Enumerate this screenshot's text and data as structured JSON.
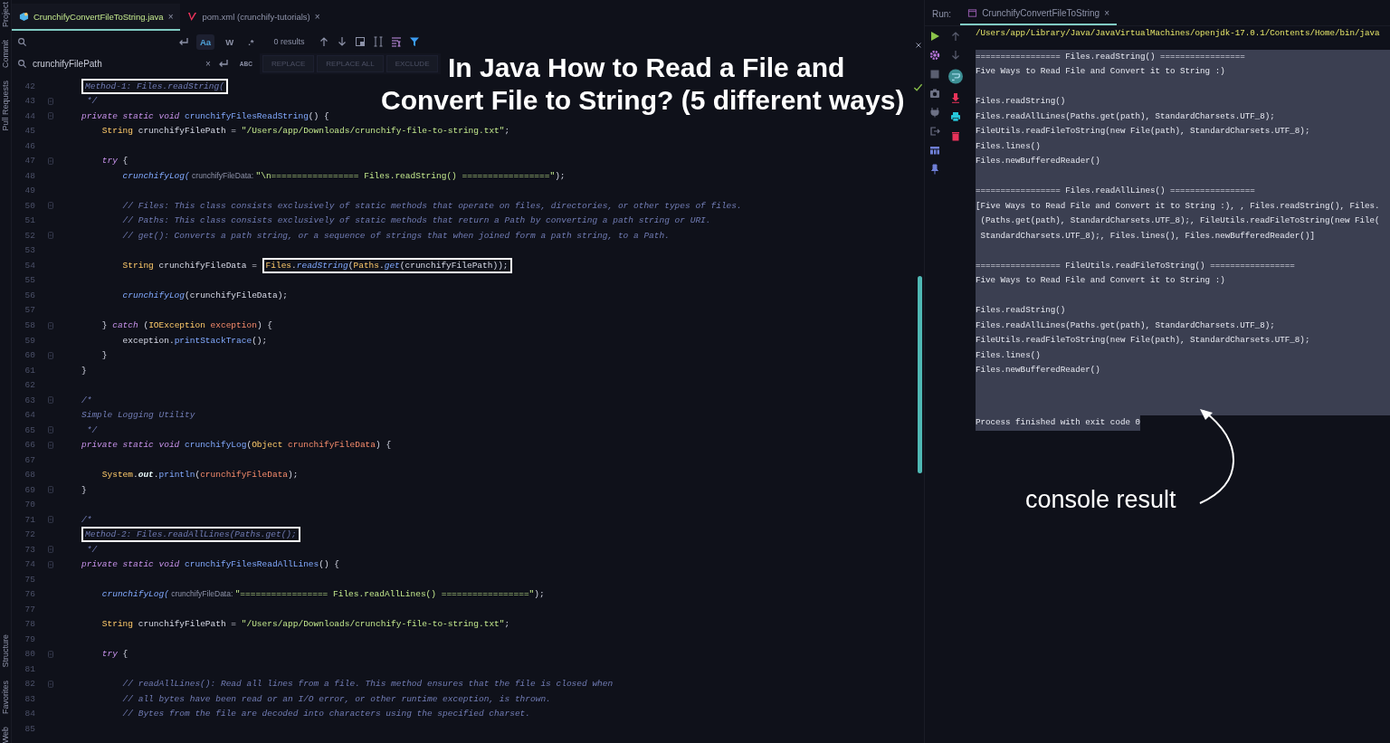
{
  "tool_strip": {
    "top": [
      {
        "label": "Project"
      },
      {
        "label": "Commit"
      },
      {
        "label": "Pull Requests"
      }
    ],
    "bottom": [
      {
        "label": "Structure"
      },
      {
        "label": "Favorites"
      },
      {
        "label": "Web"
      }
    ]
  },
  "editor_tabs": [
    {
      "label": "CrunchifyConvertFileToString.java",
      "close": "×",
      "kind": "java",
      "selected": true
    },
    {
      "label": "pom.xml (crunchify-tutorials)",
      "close": "×",
      "kind": "maven",
      "selected": false
    }
  ],
  "find_bar": {
    "options": [
      {
        "label": "Aa",
        "selected": true
      },
      {
        "label": "W",
        "selected": false
      },
      {
        "label": ".*",
        "selected": false
      }
    ],
    "results": "0 results"
  },
  "replace_bar": {
    "value": "crunchifyFilePath",
    "clear": "×",
    "preserve_case": "ABC",
    "buttons": [
      {
        "label": "REPLACE",
        "disabled": true
      },
      {
        "label": "REPLACE ALL",
        "disabled": true
      },
      {
        "label": "EXCLUDE",
        "disabled": true
      }
    ]
  },
  "code_lines": [
    {
      "number": "42",
      "fold": false,
      "boxed_tokens": [
        {
          "kind": "cm",
          "text": "Method-1: Files.readString("
        }
      ]
    },
    {
      "number": "43",
      "fold": true,
      "tokens": [
        {
          "kind": "cm",
          "text": " */"
        }
      ]
    },
    {
      "number": "44",
      "fold": true,
      "tokens": [
        {
          "kind": "kw",
          "text": "private static void "
        },
        {
          "kind": "fn",
          "text": "crunchifyFilesReadString"
        },
        {
          "kind": "pl",
          "text": "() {"
        }
      ]
    },
    {
      "number": "45",
      "fold": false,
      "tokens": [
        {
          "kind": "type",
          "text": "    String "
        },
        {
          "kind": "pl",
          "text": "crunchifyFilePath = "
        },
        {
          "kind": "str",
          "text": "\"/Users/app/Downloads/crunchify-file-to-string.txt\""
        },
        {
          "kind": "pl",
          "text": ";"
        }
      ]
    },
    {
      "number": "46",
      "fold": false
    },
    {
      "number": "47",
      "fold": true,
      "tokens": [
        {
          "kind": "kw",
          "text": "    try "
        },
        {
          "kind": "pl",
          "text": "{"
        }
      ]
    },
    {
      "number": "48",
      "fold": false,
      "tokens": [
        {
          "kind": "fni",
          "text": "        crunchifyLog("
        },
        {
          "kind": "hint",
          "text": " crunchifyFileData: "
        },
        {
          "kind": "str",
          "text": "\"\\n================= Files.readString() =================\""
        },
        {
          "kind": "pl",
          "text": ");"
        }
      ]
    },
    {
      "number": "49",
      "fold": false
    },
    {
      "number": "50",
      "fold": true,
      "tokens": [
        {
          "kind": "cm",
          "text": "        // Files: This class consists exclusively of static methods that operate on files, directories, or other types of files."
        }
      ]
    },
    {
      "number": "51",
      "fold": false,
      "tokens": [
        {
          "kind": "cm",
          "text": "        // Paths: This class consists exclusively of static methods that return a Path by converting a path string or URI."
        }
      ]
    },
    {
      "number": "52",
      "fold": true,
      "tokens": [
        {
          "kind": "cm",
          "text": "        // get(): Converts a path string, or a sequence of strings that when joined form a path string, to a Path."
        }
      ]
    },
    {
      "number": "53",
      "fold": false
    },
    {
      "number": "54",
      "fold": false,
      "tokens": [
        {
          "kind": "type",
          "text": "        String "
        },
        {
          "kind": "pl",
          "text": "crunchifyFileData = "
        }
      ],
      "boxed_tokens": [
        {
          "kind": "type",
          "text": "Files"
        },
        {
          "kind": "pl",
          "text": "."
        },
        {
          "kind": "fni",
          "text": "readString"
        },
        {
          "kind": "pl",
          "text": "("
        },
        {
          "kind": "type",
          "text": "Paths"
        },
        {
          "kind": "pl",
          "text": "."
        },
        {
          "kind": "fni",
          "text": "get"
        },
        {
          "kind": "pl",
          "text": "(crunchifyFilePath));"
        }
      ]
    },
    {
      "number": "55",
      "fold": false
    },
    {
      "number": "56",
      "fold": false,
      "tokens": [
        {
          "kind": "fni",
          "text": "        crunchifyLog"
        },
        {
          "kind": "pl",
          "text": "(crunchifyFileData);"
        }
      ]
    },
    {
      "number": "57",
      "fold": false
    },
    {
      "number": "58",
      "fold": true,
      "tokens": [
        {
          "kind": "pl",
          "text": "    } "
        },
        {
          "kind": "kw",
          "text": "catch "
        },
        {
          "kind": "pl",
          "text": "("
        },
        {
          "kind": "type",
          "text": "IOException "
        },
        {
          "kind": "var",
          "text": "exception"
        },
        {
          "kind": "pl",
          "text": ") {"
        }
      ]
    },
    {
      "number": "59",
      "fold": false,
      "tokens": [
        {
          "kind": "pl",
          "text": "        exception."
        },
        {
          "kind": "fn",
          "text": "printStackTrace"
        },
        {
          "kind": "pl",
          "text": "();"
        }
      ]
    },
    {
      "number": "60",
      "fold": true,
      "tokens": [
        {
          "kind": "pl",
          "text": "    }"
        }
      ]
    },
    {
      "number": "61",
      "fold": false,
      "tokens": [
        {
          "kind": "pl",
          "text": "}"
        }
      ]
    },
    {
      "number": "62",
      "fold": false
    },
    {
      "number": "63",
      "fold": true,
      "tokens": [
        {
          "kind": "cm",
          "text": "/*"
        }
      ]
    },
    {
      "number": "64",
      "fold": false,
      "tokens": [
        {
          "kind": "cm",
          "text": "Simple Logging Utility"
        }
      ]
    },
    {
      "number": "65",
      "fold": true,
      "tokens": [
        {
          "kind": "cm",
          "text": " */"
        }
      ]
    },
    {
      "number": "66",
      "fold": true,
      "tokens": [
        {
          "kind": "kw",
          "text": "private static void "
        },
        {
          "kind": "fn",
          "text": "crunchifyLog"
        },
        {
          "kind": "pl",
          "text": "("
        },
        {
          "kind": "type",
          "text": "Object "
        },
        {
          "kind": "var",
          "text": "crunchifyFileData"
        },
        {
          "kind": "pl",
          "text": ") {"
        }
      ]
    },
    {
      "number": "67",
      "fold": false
    },
    {
      "number": "68",
      "fold": false,
      "tokens": [
        {
          "kind": "type",
          "text": "    System"
        },
        {
          "kind": "pl",
          "text": "."
        },
        {
          "kind": "field",
          "text": "out"
        },
        {
          "kind": "pl",
          "text": "."
        },
        {
          "kind": "fn",
          "text": "println"
        },
        {
          "kind": "pl",
          "text": "("
        },
        {
          "kind": "var",
          "text": "crunchifyFileData"
        },
        {
          "kind": "pl",
          "text": ");"
        }
      ]
    },
    {
      "number": "69",
      "fold": true,
      "tokens": [
        {
          "kind": "pl",
          "text": "}"
        }
      ]
    },
    {
      "number": "70",
      "fold": false
    },
    {
      "number": "71",
      "fold": true,
      "tokens": [
        {
          "kind": "cm",
          "text": "/*"
        }
      ]
    },
    {
      "number": "72",
      "fold": false,
      "boxed_tokens": [
        {
          "kind": "cm",
          "text": "Method-2: Files.readAllLines(Paths.get();"
        }
      ]
    },
    {
      "number": "73",
      "fold": true,
      "tokens": [
        {
          "kind": "cm",
          "text": " */"
        }
      ]
    },
    {
      "number": "74",
      "fold": true,
      "tokens": [
        {
          "kind": "kw",
          "text": "private static void "
        },
        {
          "kind": "fn",
          "text": "crunchifyFilesReadAllLines"
        },
        {
          "kind": "pl",
          "text": "() {"
        }
      ]
    },
    {
      "number": "75",
      "fold": false
    },
    {
      "number": "76",
      "fold": false,
      "tokens": [
        {
          "kind": "fni",
          "text": "    crunchifyLog("
        },
        {
          "kind": "hint",
          "text": " crunchifyFileData: "
        },
        {
          "kind": "str",
          "text": "\"================= Files.readAllLines() =================\""
        },
        {
          "kind": "pl",
          "text": ");"
        }
      ]
    },
    {
      "number": "77",
      "fold": false
    },
    {
      "number": "78",
      "fold": false,
      "tokens": [
        {
          "kind": "type",
          "text": "    String "
        },
        {
          "kind": "pl",
          "text": "crunchifyFilePath = "
        },
        {
          "kind": "str",
          "text": "\"/Users/app/Downloads/crunchify-file-to-string.txt\""
        },
        {
          "kind": "pl",
          "text": ";"
        }
      ]
    },
    {
      "number": "79",
      "fold": false
    },
    {
      "number": "80",
      "fold": true,
      "tokens": [
        {
          "kind": "kw",
          "text": "    try "
        },
        {
          "kind": "pl",
          "text": "{"
        }
      ]
    },
    {
      "number": "81",
      "fold": false
    },
    {
      "number": "82",
      "fold": true,
      "tokens": [
        {
          "kind": "cm",
          "text": "        // readAllLines(): Read all lines from a file. This method ensures that the file is closed when"
        }
      ]
    },
    {
      "number": "83",
      "fold": false,
      "tokens": [
        {
          "kind": "cm",
          "text": "        // all bytes have been read or an I/O error, or other runtime exception, is thrown."
        }
      ]
    },
    {
      "number": "84",
      "fold": false,
      "tokens": [
        {
          "kind": "cm",
          "text": "        // Bytes from the file are decoded into characters using the specified charset."
        }
      ]
    },
    {
      "number": "85",
      "fold": false
    }
  ],
  "title_overlay": [
    "In Java How to Read a File and",
    "Convert File to String? (5 different ways)"
  ],
  "run_panel": {
    "label": "Run:",
    "tab": {
      "label": "CrunchifyConvertFileToString",
      "close": "×",
      "selected": true
    },
    "command": "/Users/app/Library/Java/JavaVirtualMachines/openjdk-17.0.1/Contents/Home/bin/java",
    "output_blocks": [
      [
        "================= Files.readString() =================",
        "Five Ways to Read File and Convert it to String :)"
      ],
      [
        "Files.readString()",
        "Files.readAllLines(Paths.get(path), StandardCharsets.UTF_8);",
        "FileUtils.readFileToString(new File(path), StandardCharsets.UTF_8);",
        "Files.lines()",
        "Files.newBufferedReader()"
      ],
      [
        "================= Files.readAllLines() =================",
        "[Five Ways to Read File and Convert it to String :), , Files.readString(), Files.",
        " (Paths.get(path), StandardCharsets.UTF_8);, FileUtils.readFileToString(new File(",
        " StandardCharsets.UTF_8);, Files.lines(), Files.newBufferedReader()]"
      ],
      [
        "================= FileUtils.readFileToString() =================",
        "Five Ways to Read File and Convert it to String :)"
      ],
      [
        "Files.readString()",
        "Files.readAllLines(Paths.get(path), StandardCharsets.UTF_8);",
        "FileUtils.readFileToString(new File(path), StandardCharsets.UTF_8);",
        "Files.lines()",
        "Files.newBufferedReader()"
      ]
    ],
    "exit_line": "Process finished with exit code 0",
    "annotation": "console result"
  }
}
